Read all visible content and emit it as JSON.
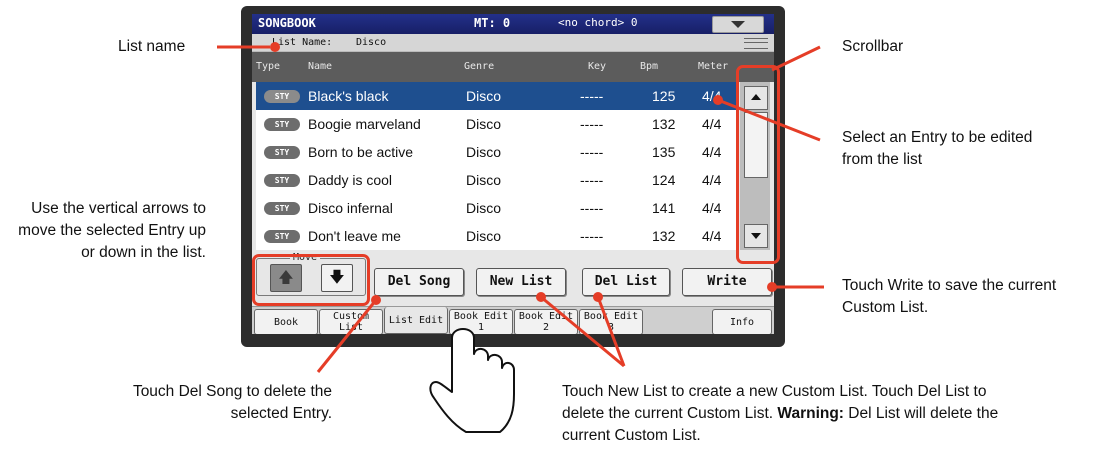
{
  "header": {
    "title": "SONGBOOK",
    "mt": "MT: 0",
    "chord": "<no chord> 0"
  },
  "list_name": {
    "label": "List Name:",
    "value": "Disco"
  },
  "columns": [
    "Type",
    "Name",
    "Genre",
    "Key",
    "Bpm",
    "Meter"
  ],
  "entries": [
    {
      "type": "STY",
      "name": "Black's black",
      "genre": "Disco",
      "key": "-----",
      "bpm": "125",
      "meter": "4/4",
      "selected": true
    },
    {
      "type": "STY",
      "name": "Boogie marveland",
      "genre": "Disco",
      "key": "-----",
      "bpm": "132",
      "meter": "4/4"
    },
    {
      "type": "STY",
      "name": "Born to be active",
      "genre": "Disco",
      "key": "-----",
      "bpm": "135",
      "meter": "4/4"
    },
    {
      "type": "STY",
      "name": "Daddy is cool",
      "genre": "Disco",
      "key": "-----",
      "bpm": "124",
      "meter": "4/4"
    },
    {
      "type": "STY",
      "name": "Disco infernal",
      "genre": "Disco",
      "key": "-----",
      "bpm": "141",
      "meter": "4/4"
    },
    {
      "type": "STY",
      "name": "Don't leave me",
      "genre": "Disco",
      "key": "-----",
      "bpm": "132",
      "meter": "4/4"
    }
  ],
  "move": {
    "label": "Move"
  },
  "buttons": {
    "del_song": "Del Song",
    "new_list": "New List",
    "del_list": "Del List",
    "write": "Write"
  },
  "tabs": [
    "Book",
    "Custom List",
    "List Edit",
    "Book Edit 1",
    "Book Edit 2",
    "Book Edit 3",
    "Info"
  ],
  "annotations": {
    "list_name": "List name",
    "scrollbar": "Scrollbar",
    "select_entry": "Select an Entry to be edited from the list",
    "vertical_arrows": "Use the vertical arrows to move the selected Entry up or down in the list.",
    "write": "Touch Write to save the current Custom List.",
    "del_song": "Touch Del Song to delete the selected Entry.",
    "new_list_a": "Touch New List to create a new Custom List. Touch Del List to delete the current Custom List.",
    "warning": "Warning:",
    "new_list_b": "Del List will delete the current Custom List."
  },
  "colors": {
    "accent": "#e53d27",
    "selection": "#1e4f8f",
    "header": "#1b2472"
  }
}
